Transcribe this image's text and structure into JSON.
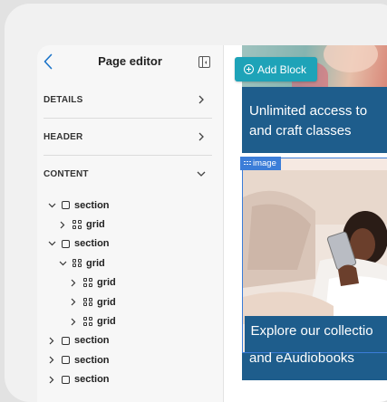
{
  "sidebar": {
    "title": "Page editor",
    "sections": [
      {
        "label": "DETAILS",
        "expanded": false
      },
      {
        "label": "HEADER",
        "expanded": false
      },
      {
        "label": "CONTENT",
        "expanded": true
      }
    ],
    "tree": [
      {
        "label": "section",
        "type": "section",
        "level": 0,
        "expanded": true
      },
      {
        "label": "grid",
        "type": "grid",
        "level": 1,
        "expanded": false
      },
      {
        "label": "section",
        "type": "section",
        "level": 0,
        "expanded": true
      },
      {
        "label": "grid",
        "type": "grid",
        "level": 1,
        "expanded": true
      },
      {
        "label": "grid",
        "type": "grid",
        "level": 2,
        "expanded": false
      },
      {
        "label": "grid",
        "type": "grid",
        "level": 2,
        "expanded": false
      },
      {
        "label": "grid",
        "type": "grid",
        "level": 2,
        "expanded": false
      },
      {
        "label": "section",
        "type": "section",
        "level": 0,
        "expanded": false
      },
      {
        "label": "section",
        "type": "section",
        "level": 0,
        "expanded": false
      },
      {
        "label": "section",
        "type": "section",
        "level": 0,
        "expanded": false
      }
    ]
  },
  "canvas": {
    "add_block_label": "Add Block",
    "banner1_line1": "Unlimited access to",
    "banner1_line2": "and craft classes",
    "image_block_label": "image",
    "banner2_line1": "Explore our collectio",
    "banner2_line2": "and eAudiobooks"
  },
  "colors": {
    "accent": "#1ea3b8",
    "banner": "#1e5d8c",
    "selection": "#3b7dd8",
    "back_link": "#1a73c8"
  }
}
